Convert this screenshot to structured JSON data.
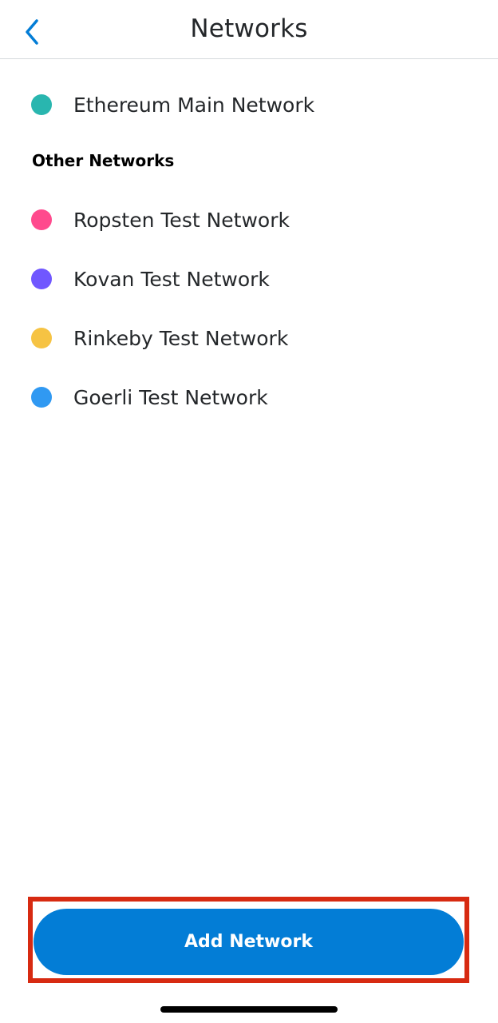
{
  "header": {
    "title": "Networks",
    "back_icon": "chevron-left-icon"
  },
  "main_network": {
    "label": "Ethereum Main Network",
    "color": "#29b6af"
  },
  "other_section": {
    "title": "Other Networks",
    "items": [
      {
        "label": "Ropsten Test Network",
        "color": "#ff4a8d"
      },
      {
        "label": "Kovan Test Network",
        "color": "#7057ff"
      },
      {
        "label": "Rinkeby Test Network",
        "color": "#f6c343"
      },
      {
        "label": "Goerli Test Network",
        "color": "#3099f2"
      }
    ]
  },
  "footer": {
    "add_button_label": "Add Network",
    "accent_color": "#037dd6",
    "highlight_color": "#d72a11"
  }
}
